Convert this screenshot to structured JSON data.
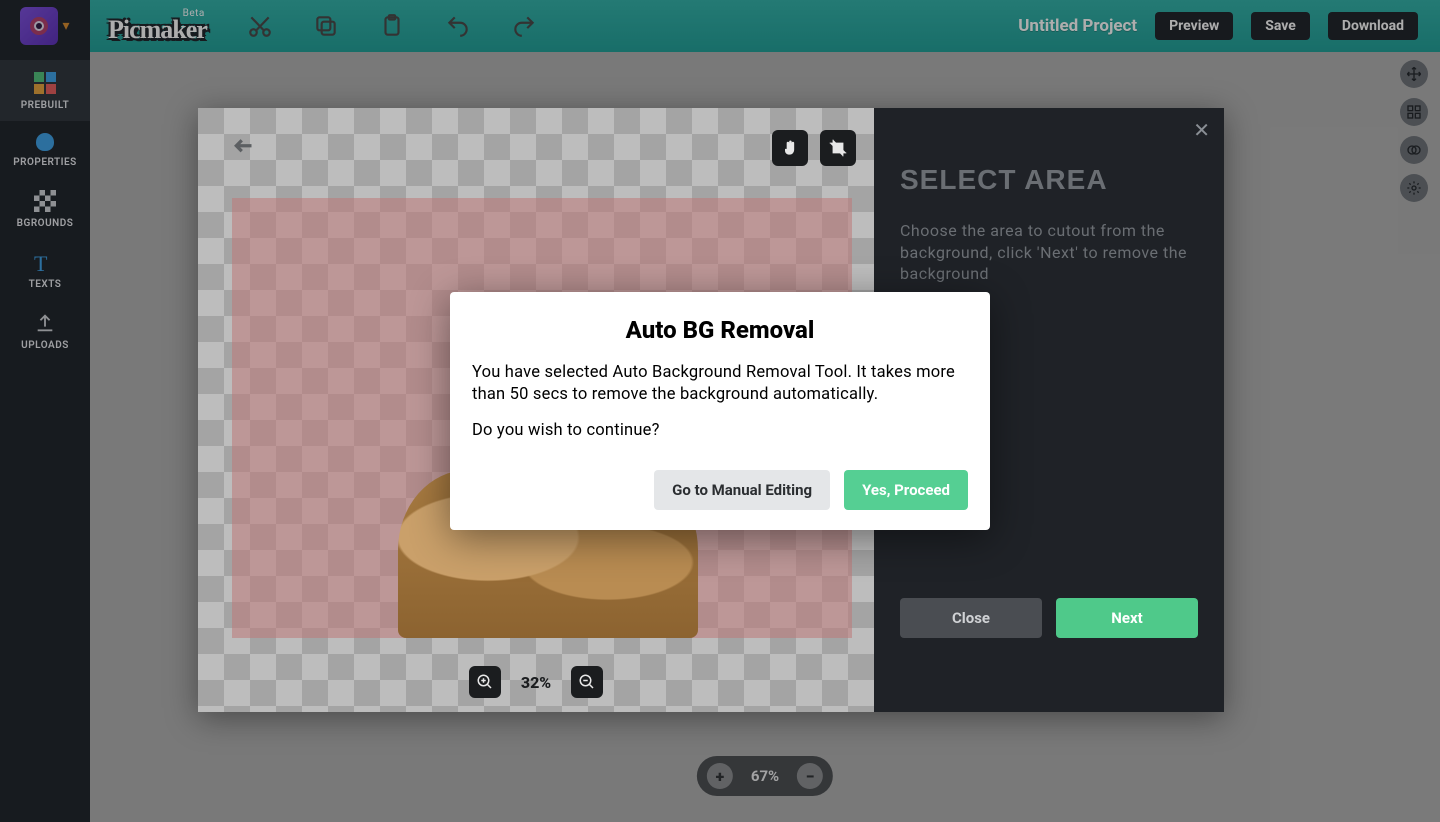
{
  "topbar": {
    "logo_beta": "Beta",
    "logo_text": "Picmaker",
    "project_title": "Untitled Project",
    "preview": "Preview",
    "save": "Save",
    "download": "Download"
  },
  "leftrail": {
    "items": [
      {
        "label": "PREBUILT"
      },
      {
        "label": "PROPERTIES"
      },
      {
        "label": "BGROUNDS"
      },
      {
        "label": "TEXTS"
      },
      {
        "label": "UPLOADS"
      }
    ]
  },
  "canvas": {
    "zoom": "67%"
  },
  "bgremove_panel": {
    "title": "SELECT AREA",
    "desc": "Choose the area to cutout from the background, click 'Next' to remove the background",
    "zoom": "32%",
    "close": "Close",
    "next": "Next"
  },
  "modal": {
    "title": "Auto BG Removal",
    "body1": "You have selected Auto Background Removal Tool. It takes more than 50 secs to remove the background automatically.",
    "body2": "Do you wish to continue?",
    "manual": "Go to Manual Editing",
    "proceed": "Yes, Proceed"
  }
}
